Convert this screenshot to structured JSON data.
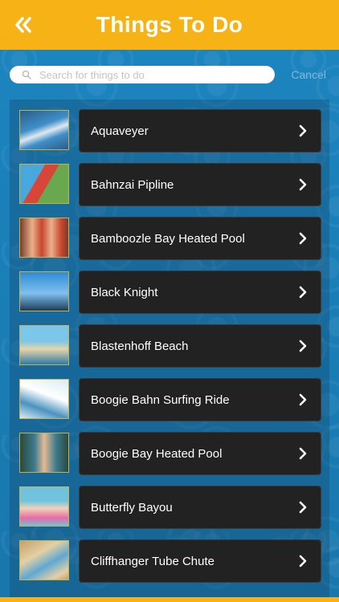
{
  "header": {
    "title": "Things To Do",
    "back_icon": "double-chevron-left-icon",
    "background": "#f7b316"
  },
  "search": {
    "placeholder": "Search for things to do",
    "value": "",
    "cancel_label": "Cancel"
  },
  "items": [
    {
      "label": "Aquaveyer",
      "thumb_colors": [
        "#3f8fc9",
        "#dfe8ee",
        "#2a5d86"
      ]
    },
    {
      "label": "Bahnzai Pipline",
      "thumb_colors": [
        "#48a7dd",
        "#d8463a",
        "#6aa84f"
      ]
    },
    {
      "label": "Bamboozle Bay Heated Pool",
      "thumb_colors": [
        "#c9472f",
        "#e9b08a",
        "#7a3b2a"
      ]
    },
    {
      "label": "Black Knight",
      "thumb_colors": [
        "#2e8bd6",
        "#7fc0ee",
        "#1c3c5a"
      ]
    },
    {
      "label": "Blastenhoff Beach",
      "thumb_colors": [
        "#7cc6e9",
        "#e8d4a9",
        "#2f7ba8"
      ]
    },
    {
      "label": "Boogie Bahn Surfing Ride",
      "thumb_colors": [
        "#d9ecf4",
        "#4b93c0",
        "#ffffff"
      ]
    },
    {
      "label": "Boogie Bay Heated Pool",
      "thumb_colors": [
        "#3c7a8c",
        "#e5b995",
        "#2a4a3c"
      ]
    },
    {
      "label": "Butterfly Bayou",
      "thumb_colors": [
        "#6fc3de",
        "#e86aa6",
        "#f0d2b8"
      ]
    },
    {
      "label": "Cliffhanger Tube Chute",
      "thumb_colors": [
        "#e3d0a5",
        "#5fa8d3",
        "#c7a06a"
      ]
    }
  ],
  "chevron_icon": "chevron-right-icon",
  "search_icon": "search-icon"
}
